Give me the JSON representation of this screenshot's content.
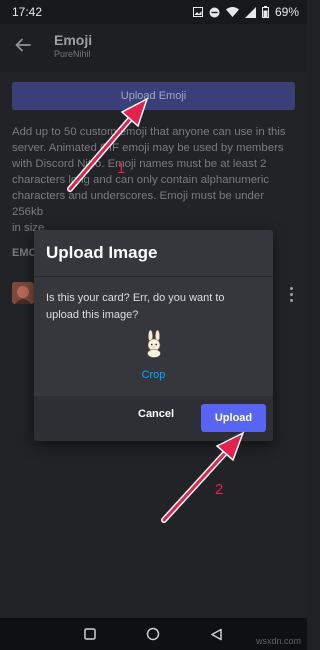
{
  "status_bar": {
    "time": "17:42",
    "battery": "69%"
  },
  "header": {
    "title": "Emoji",
    "subtitle": "PureNihil"
  },
  "page": {
    "upload_emoji_label": "Upload Emoji",
    "info_lines": [
      "Add up to 50 custom emoji that anyone can use in this",
      "server. Animated GIF emoji may be used by members",
      "with Discord Nitro. Emoji names must be at least 2",
      "characters long and can only contain alphanumeric",
      "characters and underscores. Emoji must be under 256kb",
      "in size."
    ],
    "section_label": "EMOJI"
  },
  "dialog": {
    "title": "Upload Image",
    "message_line1": "Is this your card? Err, do you want to",
    "message_line2": "upload this image?",
    "crop_label": "Crop",
    "cancel_label": "Cancel",
    "upload_label": "Upload"
  },
  "annotations": {
    "step1": "1",
    "step2": "2"
  },
  "watermark": "wsxdn.com",
  "colors": {
    "accent": "#5865f2",
    "annotation": "#e4224d",
    "link": "#00a8fc"
  },
  "icons": {
    "back": "arrow-left-icon",
    "status": [
      "gallery-icon",
      "dnd-icon",
      "wifi-icon",
      "signal-icon",
      "battery-icon"
    ],
    "nav": [
      "recents-square-icon",
      "home-circle-icon",
      "back-triangle-icon"
    ]
  }
}
